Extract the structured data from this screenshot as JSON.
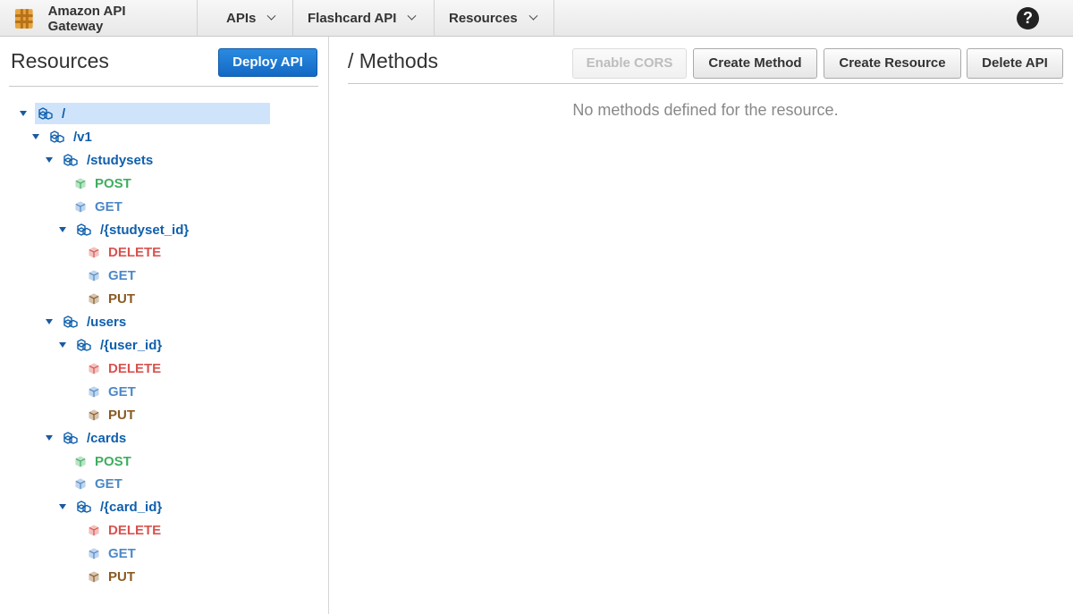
{
  "topbar": {
    "app_name": "Amazon API Gateway",
    "nav": [
      "APIs",
      "Flashcard API",
      "Resources"
    ],
    "help": "?"
  },
  "left": {
    "title": "Resources",
    "deploy_label": "Deploy API"
  },
  "tree": [
    {
      "kind": "resource",
      "label": "/",
      "expanded": true,
      "selected": true
    },
    {
      "kind": "resource",
      "label": "/v1",
      "expanded": true
    },
    {
      "kind": "resource",
      "label": "/studysets",
      "expanded": true
    },
    {
      "kind": "method",
      "label": "POST"
    },
    {
      "kind": "method",
      "label": "GET"
    },
    {
      "kind": "resource",
      "label": "/{studyset_id}",
      "expanded": true
    },
    {
      "kind": "method",
      "label": "DELETE"
    },
    {
      "kind": "method",
      "label": "GET"
    },
    {
      "kind": "method",
      "label": "PUT"
    },
    {
      "kind": "resource",
      "label": "/users",
      "expanded": true
    },
    {
      "kind": "resource",
      "label": "/{user_id}",
      "expanded": true
    },
    {
      "kind": "method",
      "label": "DELETE"
    },
    {
      "kind": "method",
      "label": "GET"
    },
    {
      "kind": "method",
      "label": "PUT"
    },
    {
      "kind": "resource",
      "label": "/cards",
      "expanded": true
    },
    {
      "kind": "method",
      "label": "POST"
    },
    {
      "kind": "method",
      "label": "GET"
    },
    {
      "kind": "resource",
      "label": "/{card_id}",
      "expanded": true
    },
    {
      "kind": "method",
      "label": "DELETE"
    },
    {
      "kind": "method",
      "label": "GET"
    },
    {
      "kind": "method",
      "label": "PUT"
    }
  ],
  "right": {
    "title": "/ Methods",
    "buttons": {
      "enable_cors": "Enable CORS",
      "create_method": "Create Method",
      "create_resource": "Create Resource",
      "delete_api": "Delete API"
    },
    "empty_message": "No methods defined for the resource."
  },
  "colors": {
    "accent": "#1a73d0",
    "post": "#3fae5f",
    "get": "#4d88c7",
    "delete": "#d9534f",
    "put": "#8a5a22",
    "resource": "#0f5fad"
  }
}
